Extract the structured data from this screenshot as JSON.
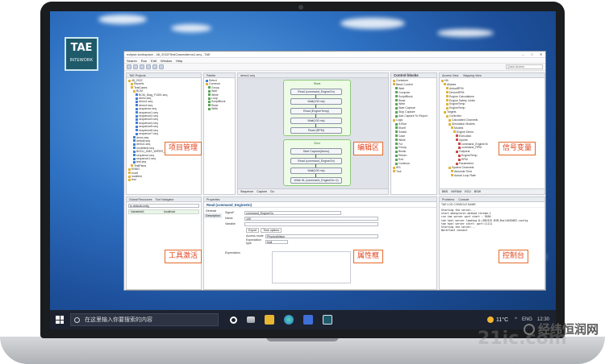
{
  "logo": {
    "main": "TAE",
    "sub": "INTEWORK"
  },
  "window": {
    "title": "eclipse-workspace - 48_2022/TestCases/demo1.seq - TAE",
    "menu": [
      "Search",
      "Run",
      "Edit",
      "Window",
      "Help"
    ],
    "search_placeholder": "Quick Access"
  },
  "projects": {
    "tab": "TAE Projects",
    "items": [
      "48_2022",
      "Reports",
      "TestCases",
      "BCM",
      "BCM_Diag_F1501.seq",
      "demo.seq",
      "demo1.seq",
      "demo2.seq",
      "sequence.seq",
      "sequence1.seq",
      "sequence2.seq",
      "sequence3.seq",
      "sequence4.seq",
      "sequence5.seq",
      "sequence6.seq",
      "sequence7.seq",
      "demo.seq",
      "default.seq",
      "demo1.seq",
      "modeltest.seq",
      "BDCU_DMS_WIPER_BEMCF.xml",
      "sequence.seq",
      "sequence1.seq",
      "test.seq",
      "TestPlans",
      "ENNO",
      "excel",
      "localtest",
      "test"
    ],
    "annotation": "项目管理"
  },
  "palette": {
    "tab": "Palette",
    "select": "Select",
    "group": "Common",
    "items": [
      "Group",
      "Wait",
      "While",
      "Loop",
      "ScriptBlock",
      "Read",
      "Write"
    ]
  },
  "editor": {
    "tab": "demo1.seq",
    "lane1": "Start",
    "lane1_nodes": [
      "Read (command_EngineOn)",
      "Wait(100 ms)",
      "Read (EngineTemp)",
      "Wait(100 ms)",
      "Read (RPM)"
    ],
    "lane2": "End",
    "lane2_nodes": [
      "Start Capture(demo)",
      "Read (command_EngineOn)",
      "Wait(100 ms)",
      "Write HL (command_EngineOn=1)"
    ],
    "bottom_tabs": [
      "Sequence",
      "Capture",
      "Go"
    ],
    "annotation": "编辑区"
  },
  "control_blocks": {
    "title": "Control blocks",
    "items": [
      "Container",
      "Basic Control",
      "Wait",
      "Compute",
      "ScriptBlock",
      "Read",
      "Write",
      "Start Capture",
      "Stop Capture",
      "Add Capture To Report",
      "Logic",
      "If-Else",
      "ElseIf",
      "Switch",
      "Case",
      "While",
      "For",
      "Group",
      "Break",
      "Return",
      "Exit",
      "Continue",
      "IES",
      "Tool"
    ]
  },
  "access_view": {
    "tabs": [
      "Access View",
      "Mapping View"
    ],
    "items": [
      "HIL",
      "Aliases",
      "ActualRPM",
      "DeviceRPM",
      "Engine Calculations",
      "Engine Safety Limits",
      "EngineTemp",
      "EngineTemp",
      "Targets",
      "Controller",
      "Calculated Channels",
      "Simulation Models",
      "Models",
      "Engine Demo",
      "Execution",
      "Inports",
      "command_EngineOn",
      "command_RPM",
      "Outports",
      "EngineTemp",
      "RPM",
      "Parameters",
      "System Channels",
      "Absolute Time",
      "Actual Loop Rate"
    ],
    "bottom_tabs": [
      "BBS",
      "NVRAM",
      "ECU",
      "BSW"
    ],
    "annotation": "信号变量"
  },
  "global_resources": {
    "tabs": [
      "Global Resources",
      "Tool Navigator"
    ],
    "filter": "ts.defaultconfig",
    "columns": [
      "Variable#1",
      "localhost"
    ],
    "annotation": "工具激活"
  },
  "properties": {
    "tab": "Properties",
    "title": "Read (command_EngineOn)",
    "side_tabs": [
      "General",
      "Description"
    ],
    "signal_label": "Signal*",
    "signal_value": "command_EngineOn",
    "name_label": "Name",
    "name_value": "100",
    "variable_label": "Variable",
    "subtabs": [
      "Export",
      "Time options"
    ],
    "access_mode_label": "Access mode",
    "access_mode_value": "PhysicalValue",
    "expectation_label": "Expectation type",
    "expectation_value": "Null",
    "expectation_area_label": "Expectation",
    "annotation": "属性框"
  },
  "console": {
    "tabs": [
      "Problems",
      "Console"
    ],
    "header": "TAE LOG CONSOLE NAME",
    "lines": [
      "Starting the server...",
      "start doexplorer.method thread-1",
      "run tae server port start : 5050",
      "tae host server loading D:/DEVICE.BIM_Build2020R2.config",
      "tae host server start: port:11111",
      "Starting the server...",
      "Workflowt connect"
    ],
    "annotation": "控制台"
  },
  "taskbar": {
    "search": "在这里输入你要搜索的内容",
    "temperature": "11°C",
    "tray": [
      "^",
      "ENG",
      "12:30"
    ]
  },
  "watermark": "经纬恒润网"
}
